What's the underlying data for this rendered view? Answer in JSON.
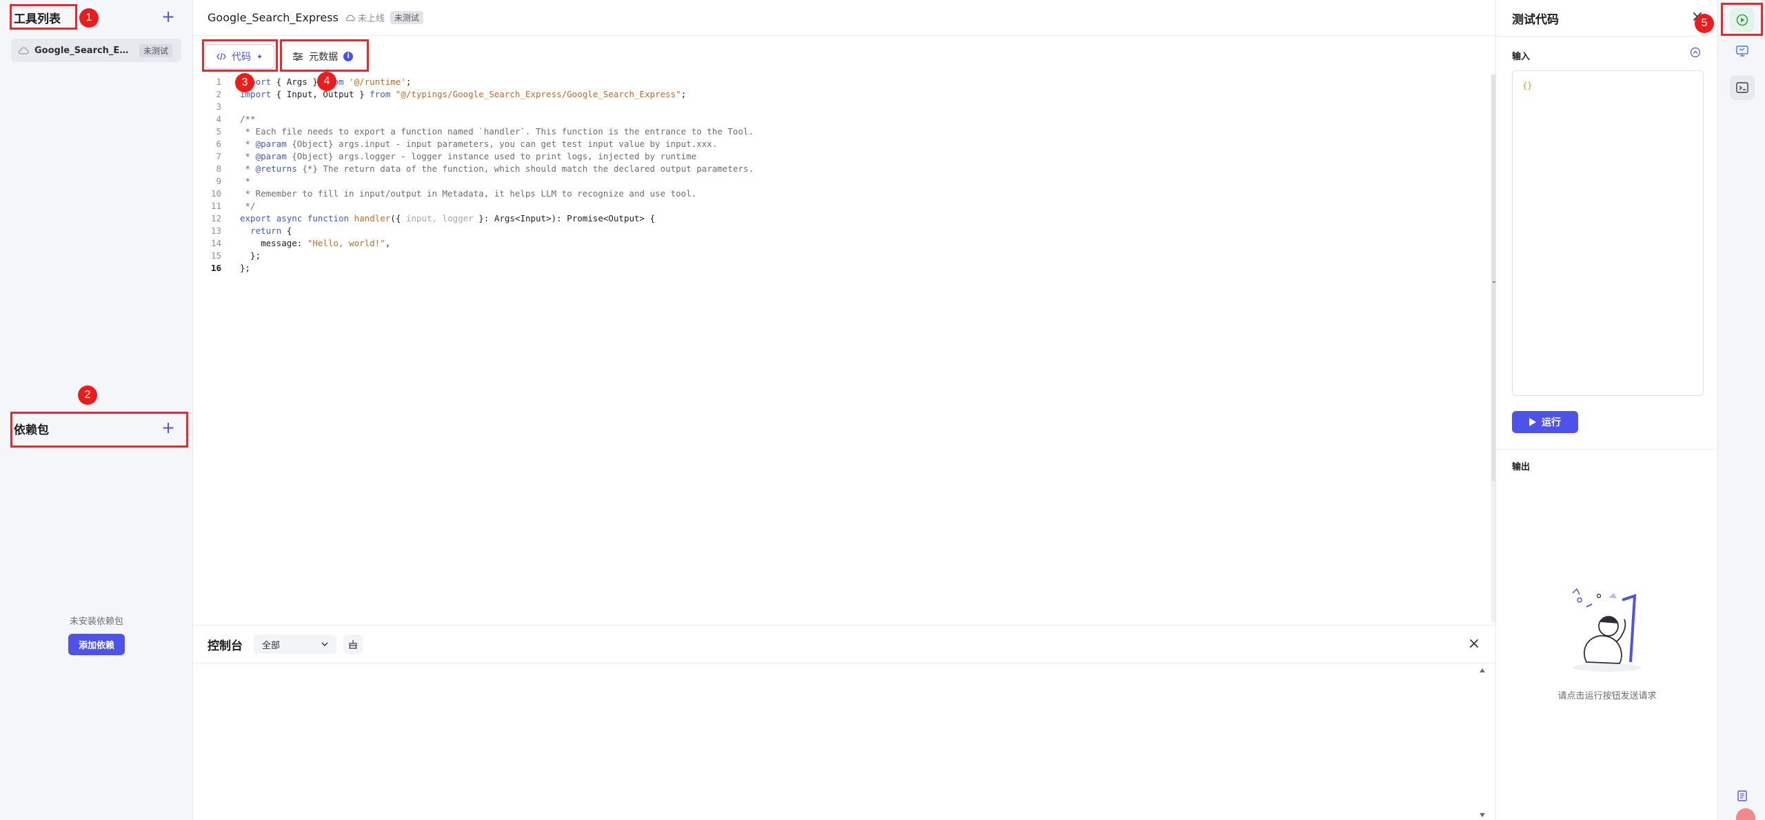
{
  "sidebar": {
    "tools_title": "工具列表",
    "tools": [
      {
        "name": "Google_Search_Expr...",
        "badge": "未测试"
      }
    ],
    "deps_title": "依赖包",
    "deps_empty_text": "未安装依赖包",
    "add_dep_label": "添加依赖"
  },
  "header": {
    "title": "Google_Search_Express",
    "status": "未上线",
    "badge": "未测试"
  },
  "tabs": {
    "code": "代码",
    "metadata": "元数据"
  },
  "editor": {
    "lines": [
      {
        "n": "1",
        "segments": [
          {
            "t": "import",
            "c": "kw"
          },
          {
            "t": " { Args } ",
            "c": ""
          },
          {
            "t": "from",
            "c": "kw"
          },
          {
            "t": " ",
            "c": ""
          },
          {
            "t": "'@/runtime'",
            "c": "str"
          },
          {
            "t": ";",
            "c": ""
          }
        ]
      },
      {
        "n": "2",
        "segments": [
          {
            "t": "import",
            "c": "kw"
          },
          {
            "t": " { Input, Output } ",
            "c": ""
          },
          {
            "t": "from",
            "c": "kw"
          },
          {
            "t": " ",
            "c": ""
          },
          {
            "t": "\"@/typings/Google_Search_Express/Google_Search_Express\"",
            "c": "str"
          },
          {
            "t": ";",
            "c": ""
          }
        ]
      },
      {
        "n": "3",
        "segments": []
      },
      {
        "n": "4",
        "segments": [
          {
            "t": "/**",
            "c": "cm"
          }
        ]
      },
      {
        "n": "5",
        "segments": [
          {
            "t": " * Each file needs to export a function named `handler`. This function is the entrance to the Tool.",
            "c": "cm"
          }
        ]
      },
      {
        "n": "6",
        "segments": [
          {
            "t": " * ",
            "c": "cm"
          },
          {
            "t": "@param",
            "c": "tg"
          },
          {
            "t": " {Object} args.input - input parameters, you can get test input value by input.xxx.",
            "c": "cm"
          }
        ]
      },
      {
        "n": "7",
        "segments": [
          {
            "t": " * ",
            "c": "cm"
          },
          {
            "t": "@param",
            "c": "tg"
          },
          {
            "t": " {Object} args.logger - logger instance used to print logs, injected by runtime",
            "c": "cm"
          }
        ]
      },
      {
        "n": "8",
        "segments": [
          {
            "t": " * ",
            "c": "cm"
          },
          {
            "t": "@returns",
            "c": "tg"
          },
          {
            "t": " {*} The return data of the function, which should match the declared output parameters.",
            "c": "cm"
          }
        ]
      },
      {
        "n": "9",
        "segments": [
          {
            "t": " *",
            "c": "cm"
          }
        ]
      },
      {
        "n": "10",
        "segments": [
          {
            "t": " * Remember to fill in input/output in Metadata, it helps LLM to recognize and use tool.",
            "c": "cm"
          }
        ]
      },
      {
        "n": "11",
        "segments": [
          {
            "t": " */",
            "c": "cm"
          }
        ]
      },
      {
        "n": "12",
        "segments": [
          {
            "t": "export",
            "c": "kw"
          },
          {
            "t": " ",
            "c": ""
          },
          {
            "t": "async",
            "c": "kw"
          },
          {
            "t": " ",
            "c": ""
          },
          {
            "t": "function",
            "c": "kw"
          },
          {
            "t": " ",
            "c": ""
          },
          {
            "t": "handler",
            "c": "str"
          },
          {
            "t": "({ ",
            "c": ""
          },
          {
            "t": "input, logger",
            "c": "mute"
          },
          {
            "t": " }: Args<Input>): Promise<Output> {",
            "c": ""
          }
        ]
      },
      {
        "n": "13",
        "segments": [
          {
            "t": "  ",
            "c": ""
          },
          {
            "t": "return",
            "c": "kw"
          },
          {
            "t": " {",
            "c": ""
          }
        ]
      },
      {
        "n": "14",
        "segments": [
          {
            "t": "    message: ",
            "c": ""
          },
          {
            "t": "\"Hello, world!\"",
            "c": "str"
          },
          {
            "t": ",",
            "c": ""
          }
        ]
      },
      {
        "n": "15",
        "segments": [
          {
            "t": "  };",
            "c": ""
          }
        ]
      },
      {
        "n": "16",
        "segments": [
          {
            "t": "};",
            "c": ""
          }
        ],
        "current": true
      }
    ]
  },
  "console": {
    "title": "控制台",
    "filter_value": "全部"
  },
  "test_panel": {
    "title": "测试代码",
    "input_label": "输入",
    "input_value": "{}",
    "run_label": "运行",
    "output_label": "输出",
    "empty_text": "请点击运行按钮发送请求"
  },
  "annotations": [
    "1",
    "2",
    "3",
    "4",
    "5"
  ],
  "colors": {
    "accent": "#4d53e8",
    "annotation": "#e32b2b"
  }
}
